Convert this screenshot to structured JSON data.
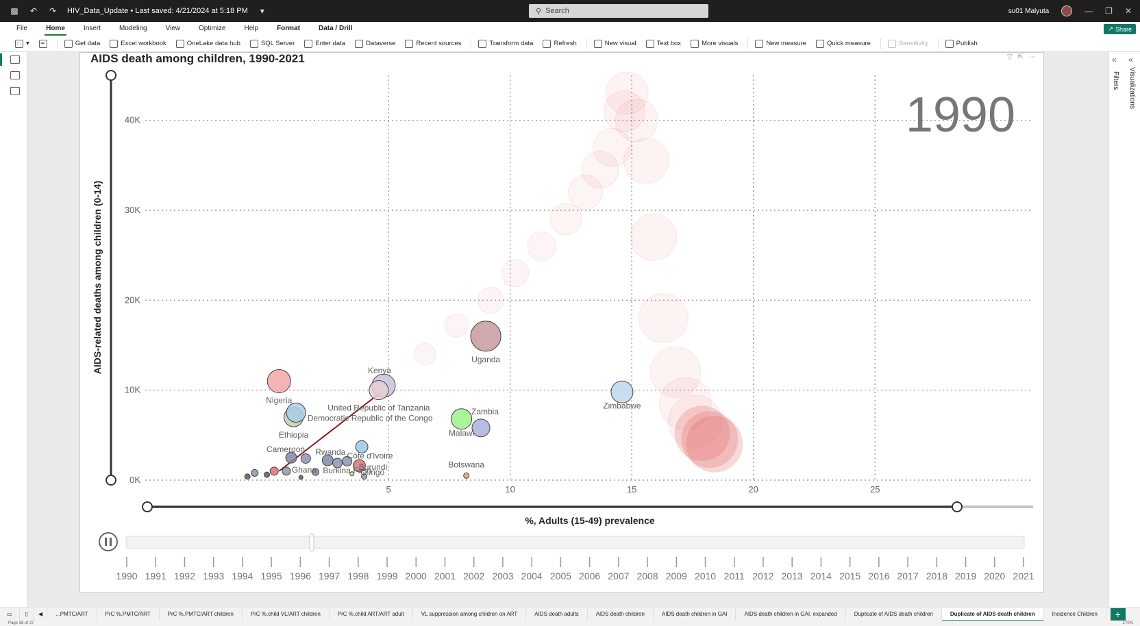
{
  "titlebar": {
    "doc_title": "HIV_Data_Update • Last saved: 4/21/2024 at 5:18 PM",
    "search_placeholder": "Search",
    "user": "su01 Malyuta"
  },
  "menu": [
    "File",
    "Home",
    "Insert",
    "Modeling",
    "View",
    "Optimize",
    "Help",
    "Format",
    "Data / Drill"
  ],
  "menu_active": "Home",
  "share_label": "Share",
  "ribbon": [
    {
      "label": "Get data",
      "icon": "database-icon"
    },
    {
      "label": "Excel workbook",
      "icon": "excel-icon"
    },
    {
      "label": "OneLake data hub",
      "icon": "onelake-icon"
    },
    {
      "label": "SQL Server",
      "icon": "sql-icon"
    },
    {
      "label": "Enter data",
      "icon": "table-icon"
    },
    {
      "label": "Dataverse",
      "icon": "dataverse-icon"
    },
    {
      "label": "Recent sources",
      "icon": "recent-icon"
    },
    {
      "label": "Transform data",
      "icon": "transform-icon"
    },
    {
      "label": "Refresh",
      "icon": "refresh-icon"
    },
    {
      "label": "New visual",
      "icon": "chart-icon"
    },
    {
      "label": "Text box",
      "icon": "textbox-icon"
    },
    {
      "label": "More visuals",
      "icon": "visuals-icon"
    },
    {
      "label": "New measure",
      "icon": "calc-icon"
    },
    {
      "label": "Quick measure",
      "icon": "quick-measure-icon"
    },
    {
      "label": "Sensitivity",
      "icon": "shield-icon",
      "disabled": true
    },
    {
      "label": "Publish",
      "icon": "publish-icon"
    }
  ],
  "panes": {
    "filters": "Filters",
    "visualizations": "Visualizations"
  },
  "page_tabs": [
    "...PMTC/ART",
    "PrC %,PMTC/ART",
    "PrC %,PMTC/ART children",
    "PrC %,child VL/ART children",
    "PrC %,child ART/ART adult",
    "VL suppression among children on ART",
    "AIDS death adults",
    "AIDS death children",
    "AIDS death children in GAI",
    "AIDS death children in GAI, expanded",
    "Duplicate of AIDS death children",
    "Duplicate of AIDS death children",
    "Incidence Children"
  ],
  "active_tab_index": 11,
  "status": {
    "page": "Page 36 of 37",
    "zoom": "170%"
  },
  "chart_data": {
    "type": "scatter",
    "title": "AIDS death among children, 1990-2021",
    "xlabel": "%, Adults (15-49) prevalence",
    "ylabel": "AIDS-related deaths among children (0-14)",
    "xlim": [
      -5,
      31.5
    ],
    "ylim": [
      0,
      45000
    ],
    "x_ticks": [
      5,
      10,
      15,
      20,
      25
    ],
    "y_ticks": [
      0,
      10000,
      20000,
      30000,
      40000
    ],
    "y_tick_labels": [
      "0K",
      "10K",
      "20K",
      "30K",
      "40K"
    ],
    "play_year": "1990",
    "years": [
      "1990",
      "1991",
      "1992",
      "1993",
      "1994",
      "1995",
      "1996",
      "1997",
      "1998",
      "1999",
      "2000",
      "2001",
      "2002",
      "2003",
      "2004",
      "2005",
      "2006",
      "2007",
      "2008",
      "2009",
      "2010",
      "2011",
      "2012",
      "2013",
      "2014",
      "2015",
      "2016",
      "2017",
      "2018",
      "2019",
      "2020",
      "2021"
    ],
    "points": [
      {
        "name": "Nigeria",
        "x": 0.5,
        "y": 11000,
        "r": 17,
        "color": "#f4a6a8",
        "label": true
      },
      {
        "name": "Kenya",
        "x": 4.8,
        "y": 10500,
        "r": 17,
        "color": "#c8c2d9",
        "label": true
      },
      {
        "name": "United Republic of Tanzania",
        "x": 4.6,
        "y": 10000,
        "r": 14,
        "color": "#e8cfd5",
        "label": true
      },
      {
        "name": "Uganda",
        "x": 9.0,
        "y": 16000,
        "r": 22,
        "color": "#c79a9e",
        "label": true
      },
      {
        "name": "Ethiopia",
        "x": 1.1,
        "y": 7000,
        "r": 14,
        "color": "#c6cdb0",
        "label": true
      },
      {
        "name": "Democratic Republic of the Congo",
        "x": 1.2,
        "y": 7500,
        "r": 14,
        "color": "#a9cde6",
        "label": true
      },
      {
        "name": "Malawi",
        "x": 8.0,
        "y": 6800,
        "r": 15,
        "color": "#9ef08a",
        "label": true
      },
      {
        "name": "Zambia",
        "x": 8.8,
        "y": 5800,
        "r": 13,
        "color": "#a9b2d9",
        "label": true
      },
      {
        "name": "Zimbabwe",
        "x": 14.6,
        "y": 9800,
        "r": 16,
        "color": "#bcd8ec",
        "label": true
      },
      {
        "name": "Rwanda",
        "x": 2.5,
        "y": 2200,
        "r": 8,
        "color": "#7f8aa3",
        "label": true
      },
      {
        "name": "Cameroon",
        "x": 1.0,
        "y": 2500,
        "r": 8,
        "color": "#7f8aa3",
        "label": true
      },
      {
        "name": "Côte d'Ivoire",
        "x": 3.9,
        "y": 3700,
        "r": 9,
        "color": "#9cc6e6",
        "label": true
      },
      {
        "name": "Burundi",
        "x": 3.8,
        "y": 1600,
        "r": 9,
        "color": "#d9747c",
        "label": true
      },
      {
        "name": "Ghana",
        "x": 0.8,
        "y": 1000,
        "r": 6,
        "color": "#8e94ad",
        "label": true
      },
      {
        "name": "Burkina Faso",
        "x": 2.0,
        "y": 900,
        "r": 5,
        "color": "#7f8aa3",
        "label": true
      },
      {
        "name": "Congo",
        "x": 4.0,
        "y": 400,
        "r": 4,
        "color": "#8e94ad",
        "label": true
      },
      {
        "name": "Botswana",
        "x": 8.2,
        "y": 500,
        "r": 4,
        "color": "#e89a7a",
        "label": true
      },
      {
        "name": "",
        "x": 1.6,
        "y": 2400,
        "r": 7,
        "color": "#8e94ad",
        "label": false
      },
      {
        "name": "",
        "x": 2.9,
        "y": 1900,
        "r": 7,
        "color": "#8e94ad",
        "label": false
      },
      {
        "name": "",
        "x": 3.3,
        "y": 2100,
        "r": 7,
        "color": "#8e94ad",
        "label": false
      },
      {
        "name": "",
        "x": 0.3,
        "y": 1000,
        "r": 6,
        "color": "#e07070",
        "label": false
      },
      {
        "name": "",
        "x": -0.5,
        "y": 800,
        "r": 5,
        "color": "#8e94ad",
        "label": false
      },
      {
        "name": "",
        "x": 0.0,
        "y": 600,
        "r": 4,
        "color": "#5a5a5a",
        "label": false
      },
      {
        "name": "",
        "x": -0.8,
        "y": 400,
        "r": 4,
        "color": "#5a5a5a",
        "label": false
      },
      {
        "name": "",
        "x": 1.4,
        "y": 300,
        "r": 3,
        "color": "#5a5a5a",
        "label": false
      },
      {
        "name": "",
        "x": 3.5,
        "y": 700,
        "r": 3,
        "color": "#9ef08a",
        "label": false
      }
    ],
    "trail": [
      {
        "x": 6.5,
        "y": 14000,
        "r": 16
      },
      {
        "x": 7.8,
        "y": 17200,
        "r": 17
      },
      {
        "x": 9.2,
        "y": 20000,
        "r": 19
      },
      {
        "x": 10.2,
        "y": 23000,
        "r": 20
      },
      {
        "x": 11.3,
        "y": 26000,
        "r": 21
      },
      {
        "x": 12.3,
        "y": 29000,
        "r": 23
      },
      {
        "x": 13.1,
        "y": 32000,
        "r": 25
      },
      {
        "x": 13.7,
        "y": 34500,
        "r": 27
      },
      {
        "x": 14.2,
        "y": 37000,
        "r": 28
      },
      {
        "x": 14.7,
        "y": 41000,
        "r": 30
      },
      {
        "x": 14.8,
        "y": 43000,
        "r": 31
      },
      {
        "x": 15.2,
        "y": 40000,
        "r": 31
      },
      {
        "x": 15.6,
        "y": 35500,
        "r": 33
      },
      {
        "x": 15.9,
        "y": 27000,
        "r": 34
      },
      {
        "x": 16.3,
        "y": 18000,
        "r": 36
      },
      {
        "x": 16.8,
        "y": 12000,
        "r": 37
      },
      {
        "x": 17.2,
        "y": 8500,
        "r": 38
      },
      {
        "x": 17.6,
        "y": 6500,
        "r": 39
      },
      {
        "x": 17.9,
        "y": 5200,
        "r": 40
      },
      {
        "x": 18.2,
        "y": 4500,
        "r": 41
      },
      {
        "x": 18.4,
        "y": 4000,
        "r": 41
      }
    ],
    "trail_color": "#e05a5a",
    "kenya_line": {
      "from": {
        "x": 0.5,
        "y": 1000
      },
      "to": {
        "x": 4.8,
        "y": 10000
      },
      "color": "#8b1a1a"
    }
  }
}
